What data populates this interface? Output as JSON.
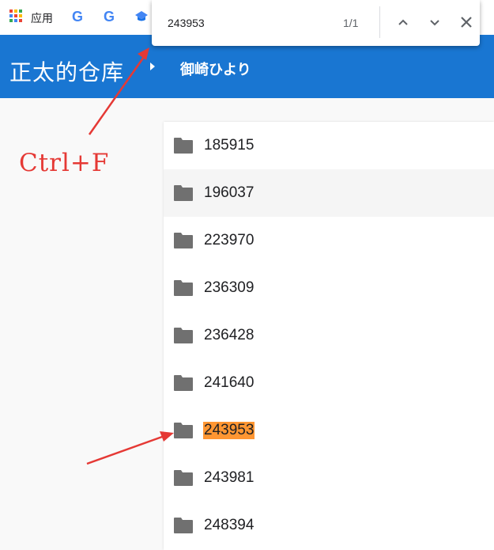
{
  "bookmarks_bar": {
    "apps_label": "应用",
    "google_letter_1": "G",
    "google_letter_2": "G",
    "apps_grid_colors": [
      "#ea4335",
      "#fbbc05",
      "#34a853",
      "#4285f4",
      "#ea4335",
      "#fbbc05",
      "#34a853",
      "#4285f4",
      "#ea4335"
    ]
  },
  "find_bar": {
    "query": "243953",
    "result_count": "1/1",
    "prev_icon": "chevron-up-icon",
    "next_icon": "chevron-down-icon",
    "close_icon": "close-icon"
  },
  "header": {
    "site_title": "正太的仓库",
    "breadcrumb_icon": "caret-right-icon",
    "breadcrumb_current": "御崎ひより",
    "background_color": "#1976d2"
  },
  "file_list": {
    "folder_icon": "folder-icon",
    "items": [
      {
        "name": "185915"
      },
      {
        "name": "196037"
      },
      {
        "name": "223970"
      },
      {
        "name": "236309"
      },
      {
        "name": "236428"
      },
      {
        "name": "241640"
      },
      {
        "name": "243953"
      },
      {
        "name": "243981"
      },
      {
        "name": "248394"
      }
    ],
    "hovered_item": "196037",
    "highlighted_item": "243953",
    "highlight_color": "#ff9632"
  },
  "annotation": {
    "label": "Ctrl+F",
    "color": "#e53935"
  }
}
